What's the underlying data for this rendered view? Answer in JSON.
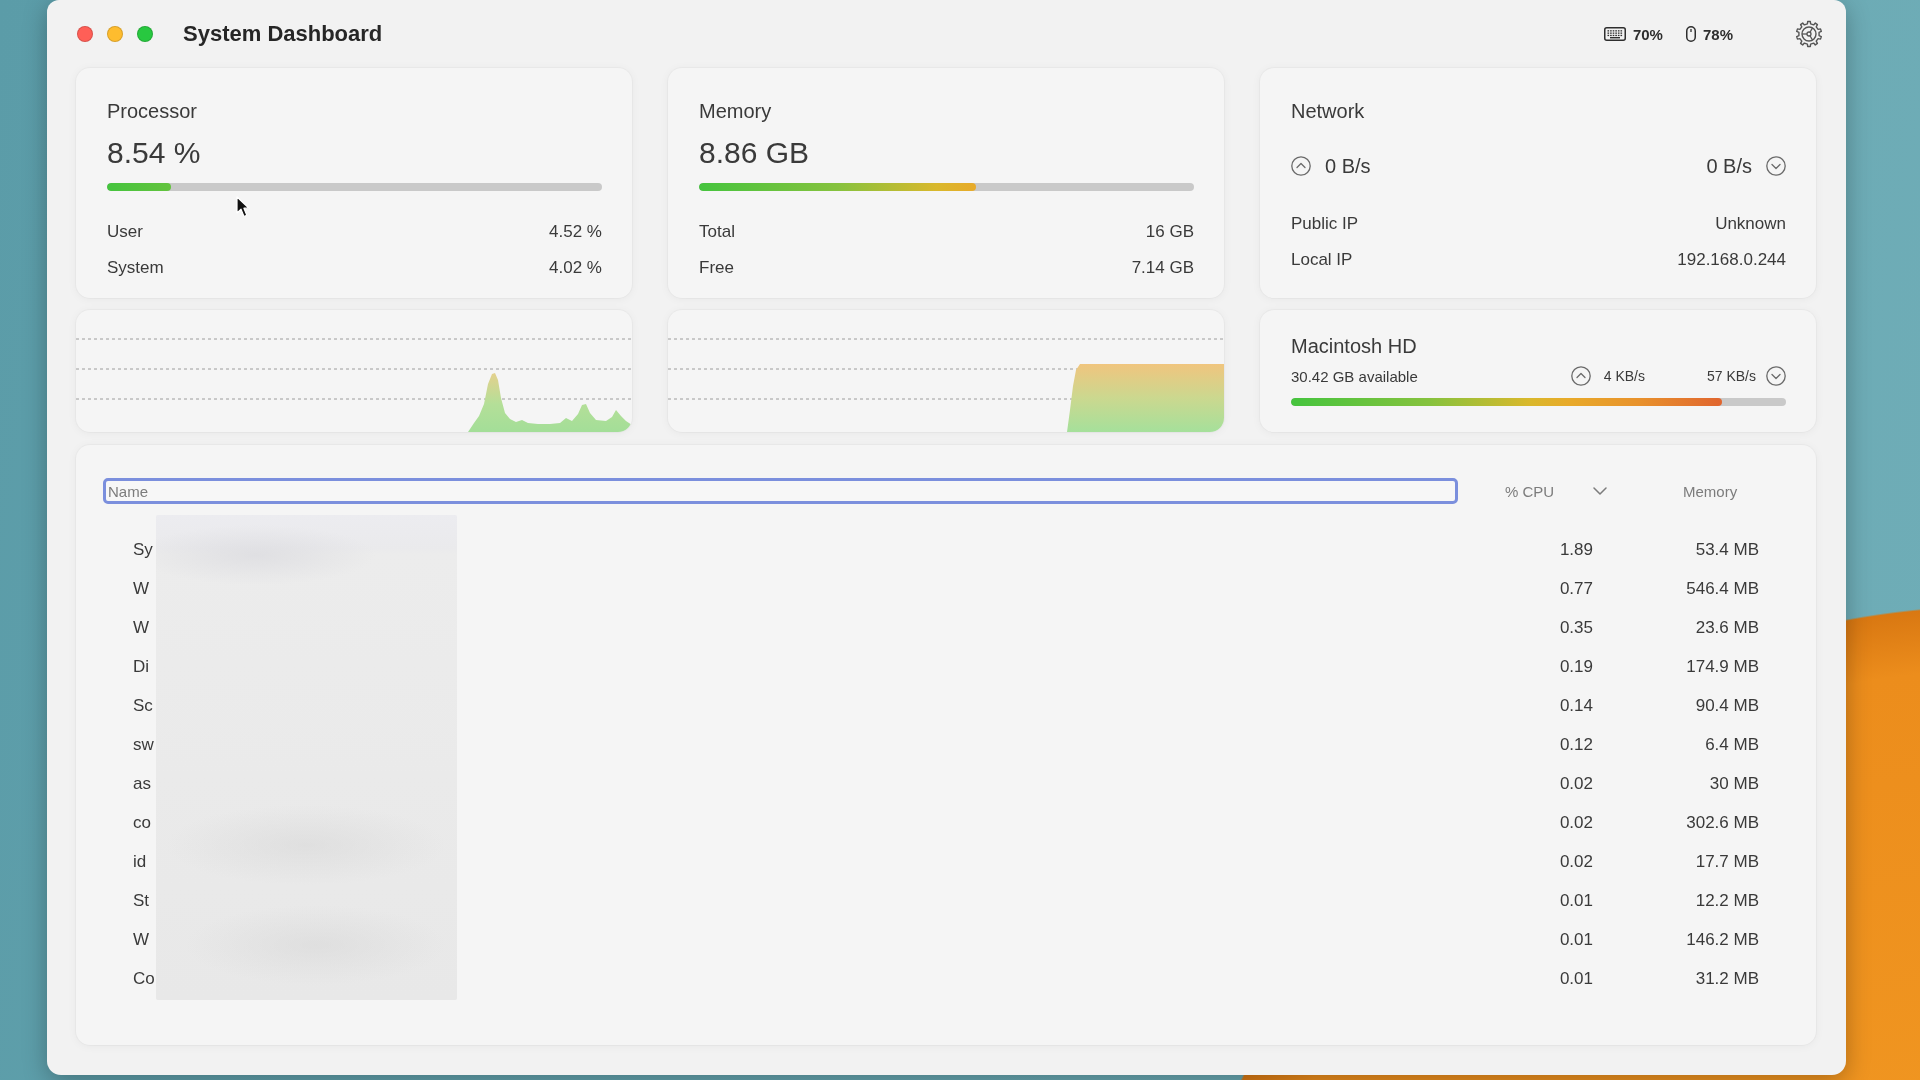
{
  "window": {
    "title": "System Dashboard"
  },
  "battery_status": [
    {
      "kind": "keyboard",
      "charge": "70%"
    },
    {
      "kind": "mouse",
      "charge": "78%"
    }
  ],
  "processor": {
    "title": "Processor",
    "value": "8.54 %",
    "level": 0.13,
    "rows": [
      {
        "label": "User",
        "value": "4.52 %"
      },
      {
        "label": "System",
        "value": "4.02 %"
      }
    ]
  },
  "memory": {
    "title": "Memory",
    "value": "8.86 GB",
    "level": 0.56,
    "rows": [
      {
        "label": "Total",
        "value": "16 GB"
      },
      {
        "label": "Free",
        "value": "7.14 GB"
      }
    ]
  },
  "network": {
    "title": "Network",
    "rate_up": "0 B/s",
    "rate_down": "0 B/s",
    "rows": [
      {
        "label": "Public IP",
        "value": "Unknown"
      },
      {
        "label": "Local IP",
        "value": "192.168.0.244"
      }
    ]
  },
  "disk": {
    "title": "Macintosh HD",
    "available": "30.42 GB available",
    "rate_up": "4 KB/s",
    "rate_down": "57 KB/s",
    "level": 0.87
  },
  "processes": {
    "columns": [
      {
        "label": "Name",
        "focused": true,
        "sorted": false
      },
      {
        "label": "% CPU",
        "focused": false,
        "sorted": true
      },
      {
        "label": "Memory",
        "focused": false,
        "sorted": false
      }
    ],
    "rows": [
      {
        "name": "Sy",
        "cpu": "1.89",
        "memory": "53.4 MB"
      },
      {
        "name": "W",
        "cpu": "0.77",
        "memory": "546.4 MB"
      },
      {
        "name": "W",
        "cpu": "0.35",
        "memory": "23.6 MB"
      },
      {
        "name": "Di",
        "cpu": "0.19",
        "memory": "174.9 MB"
      },
      {
        "name": "Sc",
        "cpu": "0.14",
        "memory": "90.4 MB"
      },
      {
        "name": "sw",
        "cpu": "0.12",
        "memory": "6.4 MB"
      },
      {
        "name": "as",
        "cpu": "0.02",
        "memory": "30 MB"
      },
      {
        "name": "co",
        "cpu": "0.02",
        "memory": "302.6 MB"
      },
      {
        "name": "id",
        "cpu": "0.02",
        "memory": "17.7 MB"
      },
      {
        "name": "St",
        "cpu": "0.01",
        "memory": "12.2 MB"
      },
      {
        "name": "W",
        "cpu": "0.01",
        "memory": "146.2 MB"
      },
      {
        "name": "Co",
        "cpu": "0.01",
        "memory": "31.2 MB"
      }
    ]
  }
}
